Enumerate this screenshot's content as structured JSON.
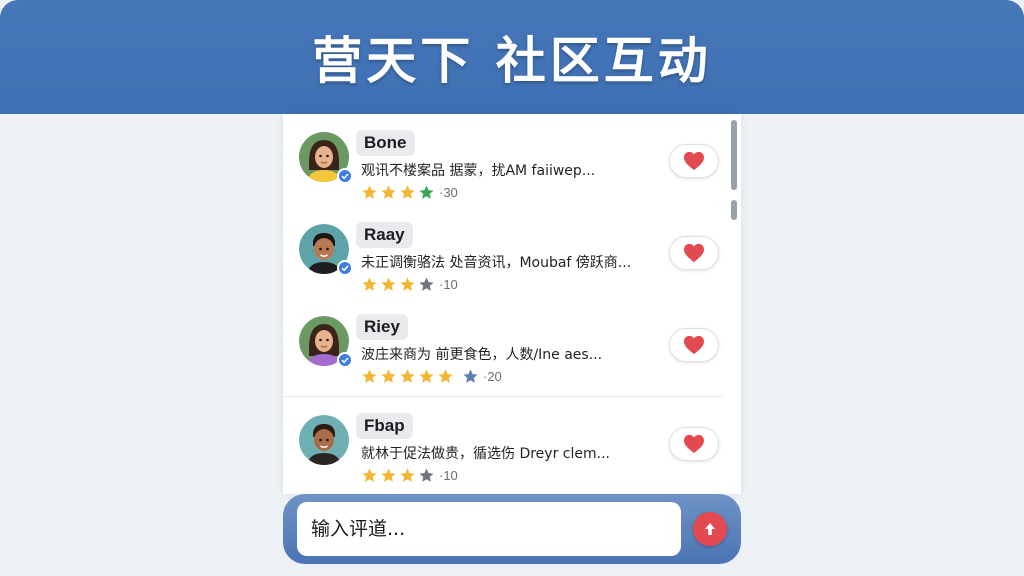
{
  "header": {
    "title": "营天下 社区互动"
  },
  "comments": [
    {
      "name": "Bone",
      "text": "观讯不楼案品 据蒙，扰AM faiiwep...",
      "stars": [
        "gold",
        "gold",
        "gold",
        "green"
      ],
      "count": "·30",
      "avatar": "female-avatar-yellow"
    },
    {
      "name": "Raay",
      "text": "未正调衡骆法 处音资讯，Moubaf 傍跃商...",
      "stars": [
        "gold",
        "gold",
        "gold",
        "gray"
      ],
      "count": "·10",
      "avatar": "male-avatar-black"
    },
    {
      "name": "Riey",
      "text": "波庄来商为 前更食色，人数/Ine aes...",
      "stars": [
        "gold",
        "gold",
        "gold",
        "gold",
        "gold",
        "blue"
      ],
      "count": "·20",
      "avatar": "female-avatar-purple"
    },
    {
      "name": "Fbap",
      "text": "就林于促法做贵，循选伤 Dreyr clem...",
      "stars": [
        "gold",
        "gold",
        "gold",
        "gray"
      ],
      "count": "·10",
      "avatar": "male-avatar-dark"
    }
  ],
  "input": {
    "placeholder": "输入评道..."
  },
  "colors": {
    "header": "#4476b8",
    "like_heart": "#e24a4f",
    "star_gold": "#f2b632",
    "star_green": "#3aa657",
    "star_gray": "#6f7580",
    "star_blue": "#5a7fb0",
    "verified": "#3b7de0",
    "send_button": "#e24a4f"
  }
}
